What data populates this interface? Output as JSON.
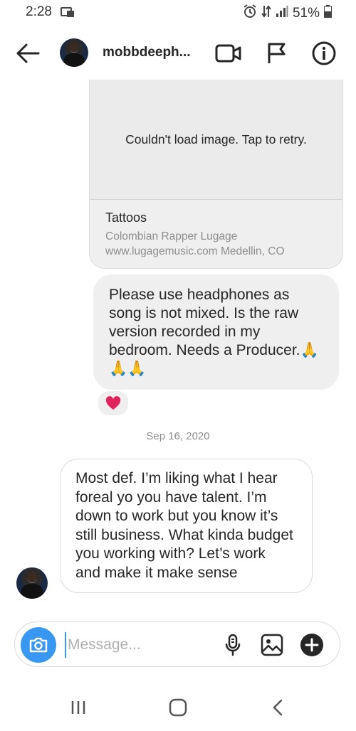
{
  "status_bar": {
    "time": "2:28",
    "battery": "51%"
  },
  "header": {
    "username": "mobbdeeph...",
    "icons": [
      "back-arrow-icon",
      "video-call-icon",
      "flag-icon",
      "info-icon"
    ]
  },
  "messages": {
    "shared_post": {
      "error_text": "Couldn't load image. Tap to retry.",
      "title": "Tattoos",
      "desc_line1": "Colombian Rapper Lugage",
      "desc_line2": "www.lugagemusic.com Medellin, CO"
    },
    "outgoing_text": "Please use headphones as song is not mixed. Is the raw version recorded in my bedroom. Needs a Producer.🙏🙏🙏",
    "reaction": "❤️",
    "date_separator": "Sep 16, 2020",
    "incoming_text": "Most def. I’m liking what I hear foreal yo you have talent. I’m down to work but you know it’s still business. What kinda budget you working with? Let’s work and make it make sense"
  },
  "composer": {
    "placeholder": "Message...",
    "value": ""
  },
  "colors": {
    "accent": "#3897f0",
    "bubble_gray": "#efeff0",
    "text": "#262626",
    "secondary_text": "#8e8e8e"
  }
}
